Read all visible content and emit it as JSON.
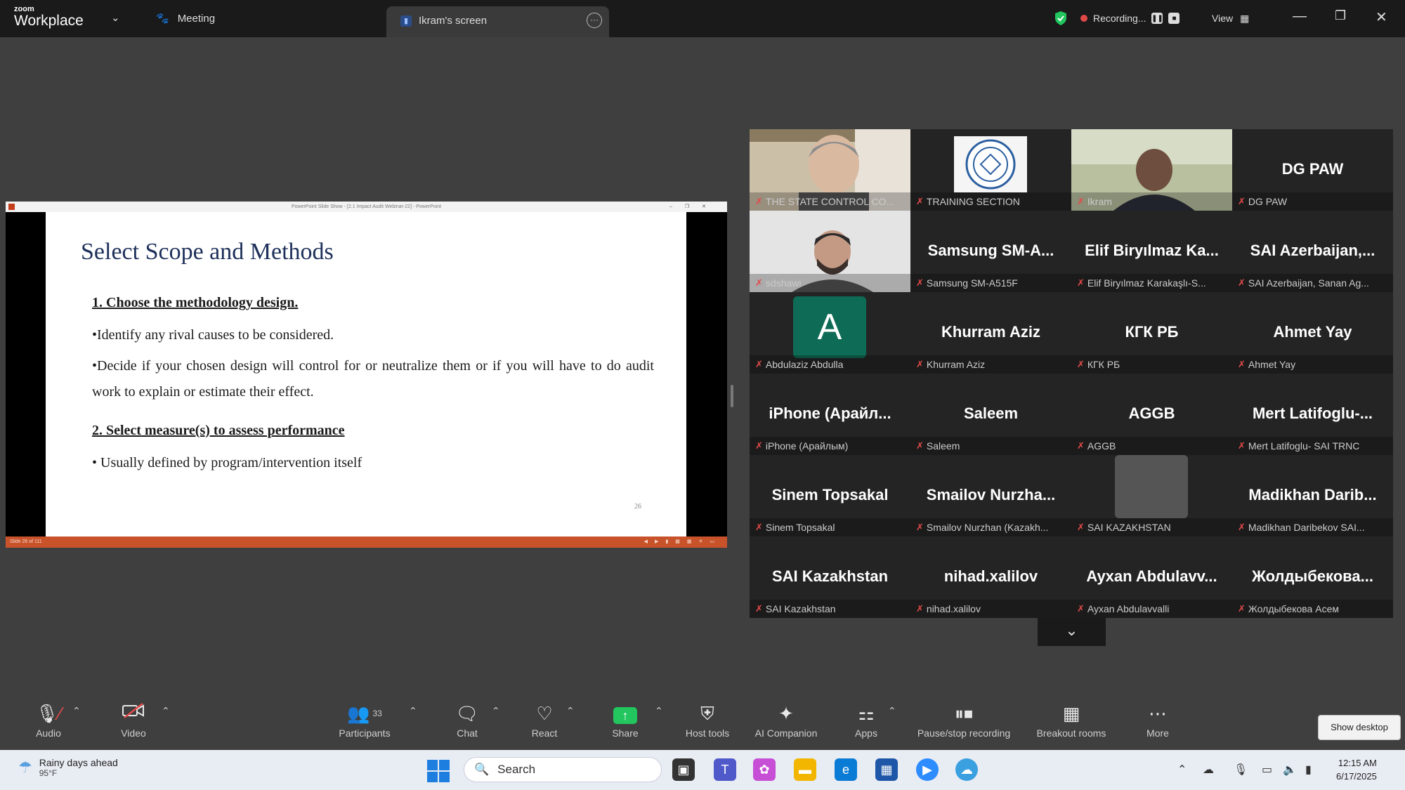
{
  "titlebar": {
    "logo_top": "zoom",
    "logo_bottom": "Workplace",
    "meeting_label": "Meeting",
    "tab_label": "Ikram's screen",
    "recording_label": "Recording...",
    "view_label": "View"
  },
  "slide": {
    "window_title": "PowerPoint Slide Show - [2.1 Impact Audit Webinar-22] - PowerPoint",
    "title": "Select Scope and Methods",
    "heading1": "1. Choose the methodology design.",
    "bullet1": "•Identify any rival causes to be considered.",
    "bullet2": "•Decide if your chosen design will control for or neutralize them or if you will have to do audit work to explain or estimate their effect.",
    "heading2": "2. Select measure(s) to assess performance",
    "bullet3": "• Usually defined by program/intervention itself",
    "page_number": "26",
    "status_text": "Slide 26 of 111"
  },
  "participants": [
    {
      "big": "",
      "name": "THE STATE CONTROL CO...",
      "video": "man-grey"
    },
    {
      "big": "",
      "name": "TRAINING SECTION",
      "video": "emblem"
    },
    {
      "big": "",
      "name": "Ikram",
      "video": "man-dark",
      "active": true
    },
    {
      "big": "DG PAW",
      "name": "DG PAW"
    },
    {
      "big": "",
      "name": "sdshawi",
      "video": "man-beard"
    },
    {
      "big": "Samsung SM-A...",
      "name": "Samsung SM-A515F"
    },
    {
      "big": "Elif Biryılmaz Ka...",
      "name": "Elif Biryılmaz Karakaşlı-S..."
    },
    {
      "big": "SAI Azerbaijan,...",
      "name": "SAI Azerbaijan, Sanan Ag..."
    },
    {
      "big": "",
      "name": "Abdulaziz Abdulla",
      "avatar": "A"
    },
    {
      "big": "Khurram Aziz",
      "name": "Khurram Aziz"
    },
    {
      "big": "КГК РБ",
      "name": "КГК РБ"
    },
    {
      "big": "Ahmet Yay",
      "name": "Ahmet Yay"
    },
    {
      "big": "iPhone (Арайл...",
      "name": "iPhone (Арайлым)"
    },
    {
      "big": "Saleem",
      "name": "Saleem"
    },
    {
      "big": "AGGB",
      "name": "AGGB"
    },
    {
      "big": "Mert Latifoglu-...",
      "name": "Mert Latifoglu- SAI TRNC"
    },
    {
      "big": "Sinem Topsakal",
      "name": "Sinem Topsakal"
    },
    {
      "big": "Smailov Nurzha...",
      "name": "Smailov Nurzhan (Kazakh..."
    },
    {
      "big": "",
      "name": "SAI KAZAKHSTAN",
      "grey": true
    },
    {
      "big": "Madikhan Darib...",
      "name": "Madikhan Daribekov SAI..."
    },
    {
      "big": "SAI Kazakhstan",
      "name": "SAI Kazakhstan"
    },
    {
      "big": "nihad.xalilov",
      "name": "nihad.xalilov"
    },
    {
      "big": "Ayxan Abdulavv...",
      "name": "Ayxan Abdulavvalli"
    },
    {
      "big": "Жолдыбекова...",
      "name": "Жолдыбекова Асем"
    }
  ],
  "toolbar": {
    "audio": "Audio",
    "video": "Video",
    "participants": "Participants",
    "participants_count": "33",
    "chat": "Chat",
    "react": "React",
    "share": "Share",
    "host_tools": "Host tools",
    "ai_companion": "AI Companion",
    "apps": "Apps",
    "pause_recording": "Pause/stop recording",
    "breakout": "Breakout rooms",
    "more": "More",
    "show_desktop": "Show desktop"
  },
  "taskbar": {
    "weather_title": "Rainy days ahead",
    "weather_temp": "95°F",
    "search_placeholder": "Search",
    "time": "12:15 AM",
    "date": "6/17/2025"
  },
  "colors": {
    "accent_green": "#2bd48a",
    "share_green": "#22c55e",
    "mute_red": "#e44a4a",
    "ppt_orange": "#c8532b"
  }
}
